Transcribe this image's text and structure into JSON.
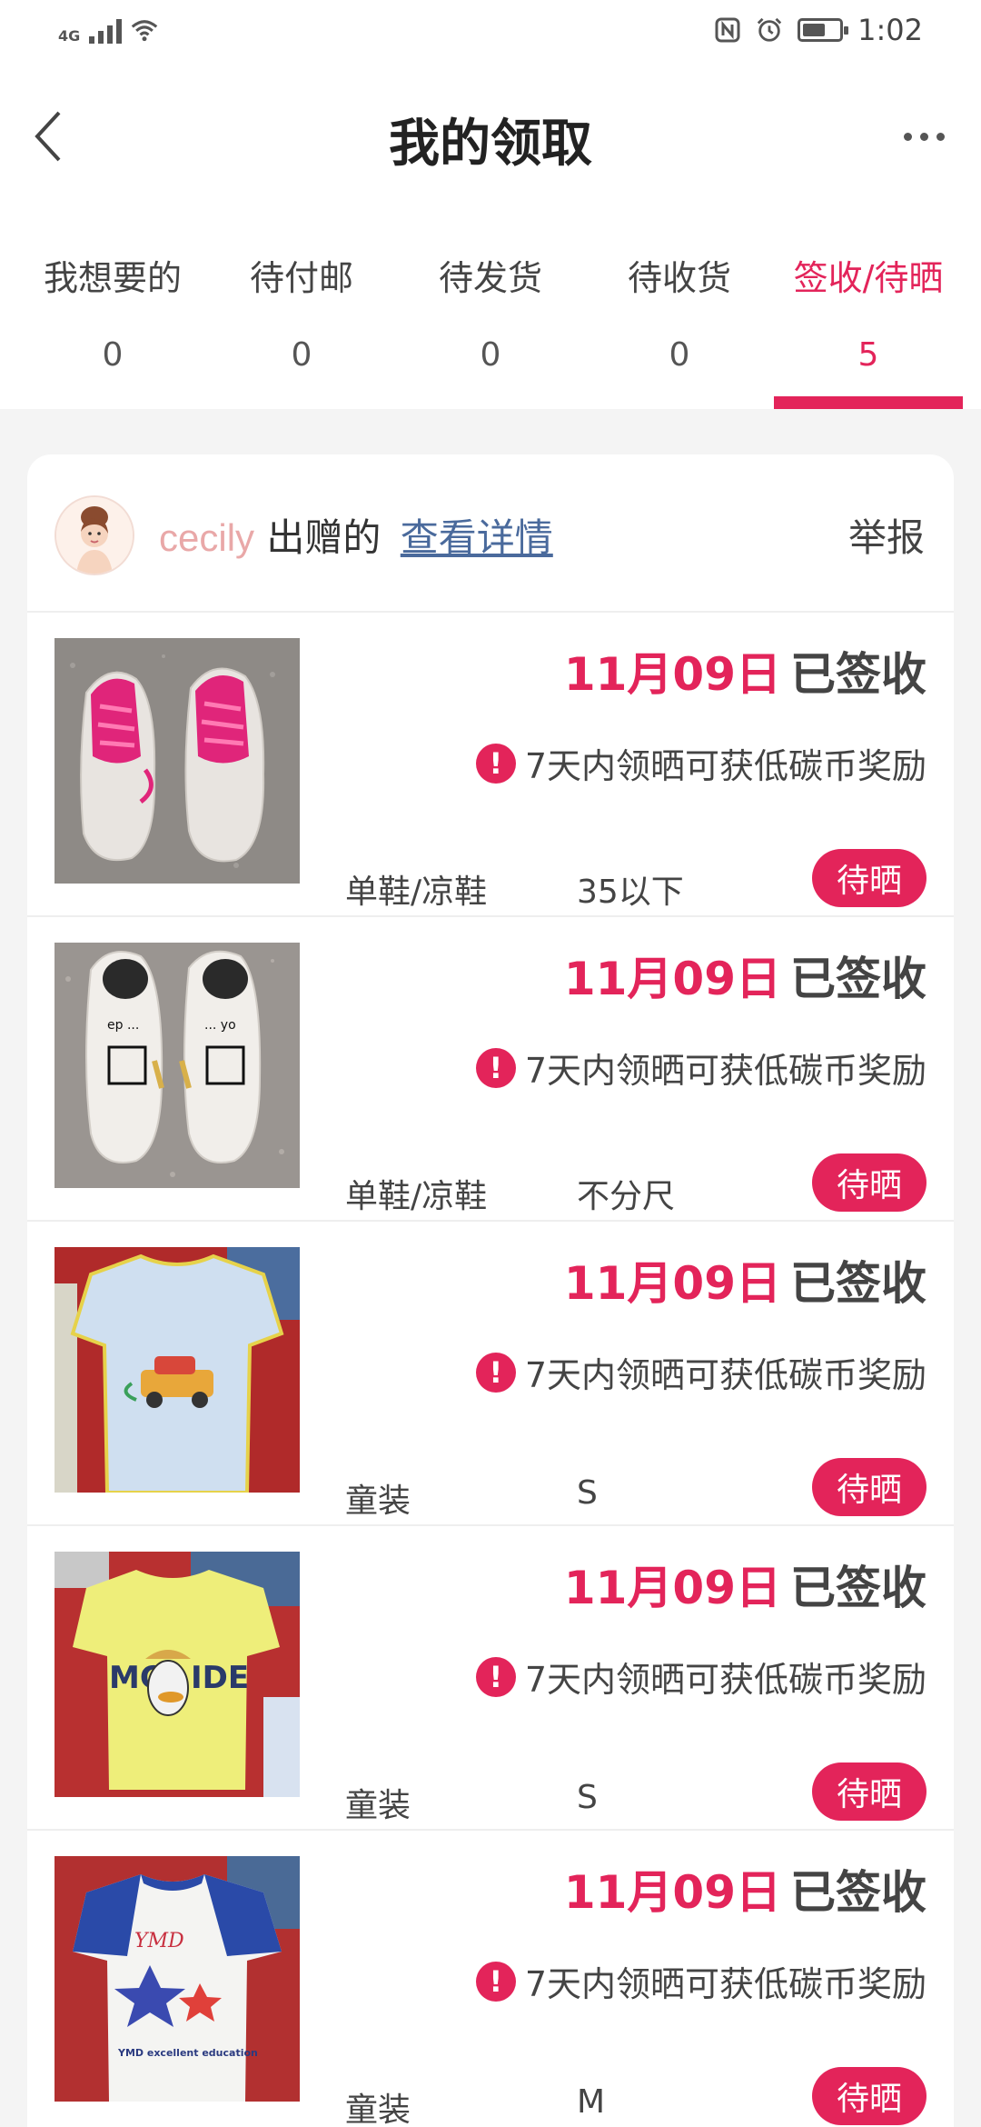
{
  "status_bar": {
    "network": "4G",
    "time": "1:02"
  },
  "header": {
    "title": "我的领取"
  },
  "tabs": [
    {
      "label": "我想要的",
      "count": "0"
    },
    {
      "label": "待付邮",
      "count": "0"
    },
    {
      "label": "待发货",
      "count": "0"
    },
    {
      "label": "待收货",
      "count": "0"
    },
    {
      "label": "签收/待晒",
      "count": "5"
    }
  ],
  "card": {
    "giver_name": "cecily",
    "giver_suffix": "出赠的",
    "detail_link": "查看详情",
    "report": "举报"
  },
  "items": [
    {
      "date": "11月09日",
      "status": "已签收",
      "notice": "7天内领晒可获低碳币奖励",
      "category": "单鞋/凉鞋",
      "size": "35以下",
      "badge": "待晒",
      "image": "pink-sneakers"
    },
    {
      "date": "11月09日",
      "status": "已签收",
      "notice": "7天内领晒可获低碳币奖励",
      "category": "单鞋/凉鞋",
      "size": "不分尺",
      "badge": "待晒",
      "image": "white-sneakers"
    },
    {
      "date": "11月09日",
      "status": "已签收",
      "notice": "7天内领晒可获低碳币奖励",
      "category": "童装",
      "size": "S",
      "badge": "待晒",
      "image": "blue-tshirt-car"
    },
    {
      "date": "11月09日",
      "status": "已签收",
      "notice": "7天内领晒可获低碳币奖励",
      "category": "童装",
      "size": "S",
      "badge": "待晒",
      "image": "yellow-tshirt-duck"
    },
    {
      "date": "11月09日",
      "status": "已签收",
      "notice": "7天内领晒可获低碳币奖励",
      "category": "童装",
      "size": "M",
      "badge": "待晒",
      "image": "white-blue-tshirt-stars"
    }
  ],
  "colors": {
    "accent": "#e3245a",
    "link": "#4a6a9c",
    "giver_name": "#e9a8a8"
  }
}
